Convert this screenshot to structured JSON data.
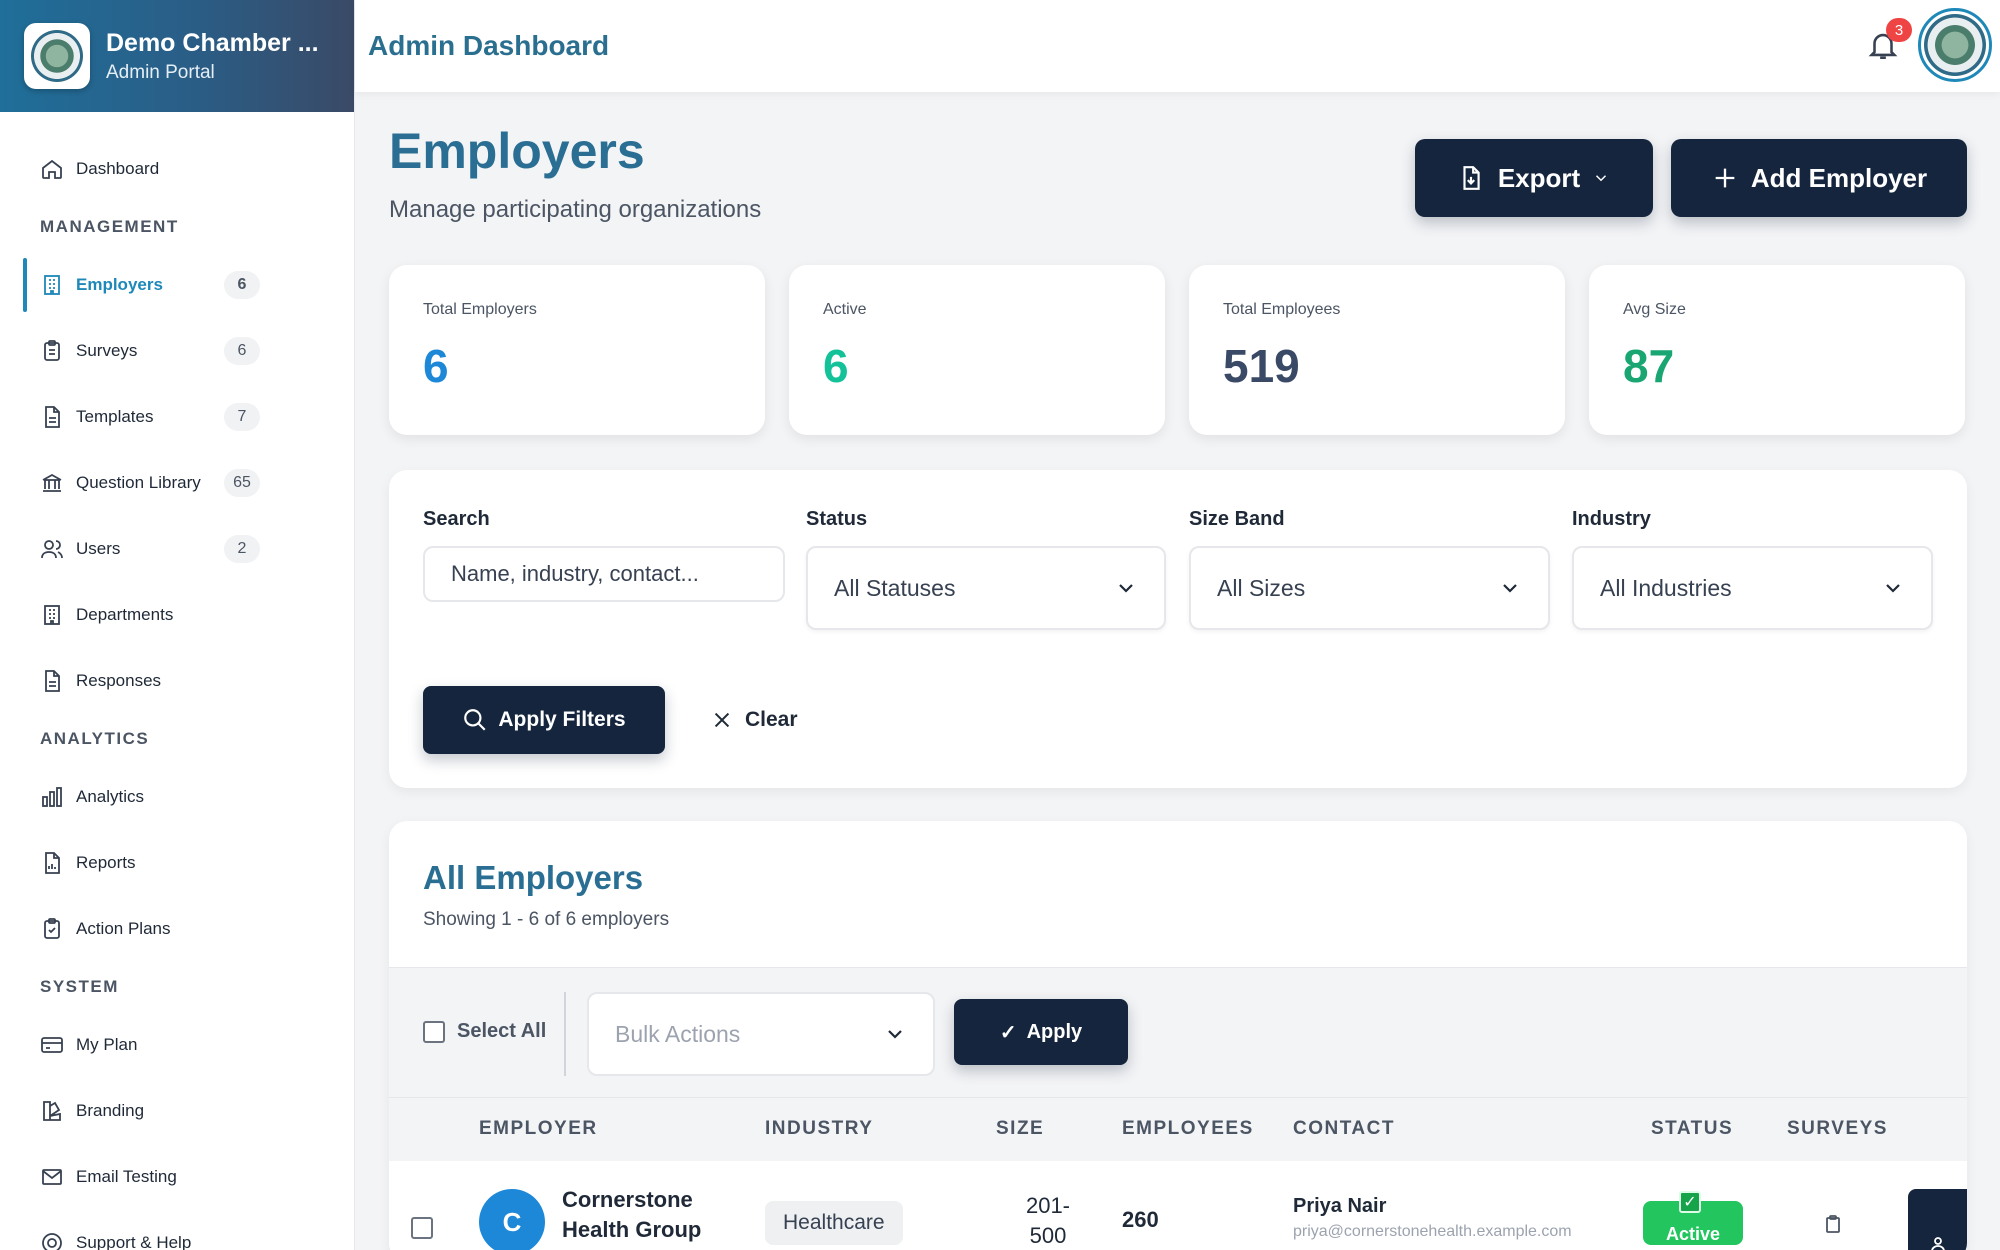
{
  "brand": {
    "title": "Demo Chamber ...",
    "subtitle": "Admin Portal"
  },
  "topbar": {
    "title": "Admin Dashboard",
    "notification_count": "3"
  },
  "sidebar": {
    "dashboard": "Dashboard",
    "section_management": "MANAGEMENT",
    "employers": {
      "label": "Employers",
      "count": "6"
    },
    "surveys": {
      "label": "Surveys",
      "count": "6"
    },
    "templates": {
      "label": "Templates",
      "count": "7"
    },
    "question_library": {
      "label": "Question Library",
      "count": "65"
    },
    "users": {
      "label": "Users",
      "count": "2"
    },
    "departments": "Departments",
    "responses": "Responses",
    "section_analytics": "ANALYTICS",
    "analytics": "Analytics",
    "reports": "Reports",
    "action_plans": "Action Plans",
    "section_system": "SYSTEM",
    "my_plan": "My Plan",
    "branding": "Branding",
    "email_testing": "Email Testing",
    "support": "Support & Help"
  },
  "page": {
    "title": "Employers",
    "subtitle": "Manage participating organizations",
    "export_label": "Export",
    "add_label": "Add Employer"
  },
  "stats": [
    {
      "label": "Total Employers",
      "value": "6",
      "color": "#1e88d8"
    },
    {
      "label": "Active",
      "value": "6",
      "color": "#14c29a"
    },
    {
      "label": "Total Employees",
      "value": "519",
      "color": "#3a4a66"
    },
    {
      "label": "Avg Size",
      "value": "87",
      "color": "#1aa672"
    }
  ],
  "filters": {
    "search_label": "Search",
    "search_placeholder": "Name, industry, contact...",
    "status_label": "Status",
    "status_value": "All Statuses",
    "size_label": "Size Band",
    "size_value": "All Sizes",
    "industry_label": "Industry",
    "industry_value": "All Industries",
    "apply_label": "Apply Filters",
    "clear_label": "Clear"
  },
  "table": {
    "title": "All Employers",
    "subtitle": "Showing 1 - 6 of 6 employers",
    "select_all": "Select All",
    "bulk_placeholder": "Bulk Actions",
    "apply_label": "Apply",
    "headers": [
      "EMPLOYER",
      "INDUSTRY",
      "SIZE",
      "EMPLOYEES",
      "CONTACT",
      "STATUS",
      "SURVEYS"
    ],
    "rows": [
      {
        "initial": "C",
        "name": "Cornerstone Health Group",
        "industry": "Healthcare",
        "size": "201-500",
        "employees": "260",
        "contact_name": "Priya Nair",
        "contact_email": "priya@cornerstonehealth.example.com",
        "status": "Active"
      }
    ]
  }
}
